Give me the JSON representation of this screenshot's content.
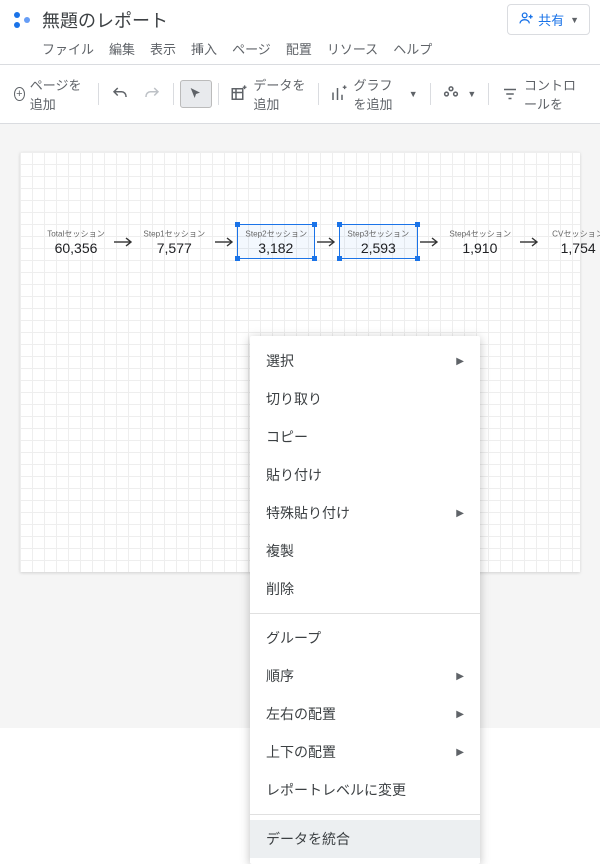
{
  "header": {
    "title": "無題のレポート",
    "share": "共有",
    "menu": [
      "ファイル",
      "編集",
      "表示",
      "挿入",
      "ページ",
      "配置",
      "リソース",
      "ヘルプ"
    ]
  },
  "toolbar": {
    "addPage": "ページを追加",
    "addData": "データを追加",
    "addChart": "グラフを追加",
    "addControl": "コントロールを"
  },
  "flow": {
    "nodes": [
      {
        "label": "Totalセッション",
        "value": "60,356"
      },
      {
        "label": "Step1セッション",
        "value": "7,577"
      },
      {
        "label": "Step2セッション",
        "value": "3,182"
      },
      {
        "label": "Step3セッション",
        "value": "2,593"
      },
      {
        "label": "Step4セッション",
        "value": "1,910"
      },
      {
        "label": "CVセッション",
        "value": "1,754"
      }
    ]
  },
  "context": {
    "select": "選択",
    "cut": "切り取り",
    "copy": "コピー",
    "paste": "貼り付け",
    "pasteSpecial": "特殊貼り付け",
    "duplicate": "複製",
    "delete": "削除",
    "group": "グループ",
    "order": "順序",
    "alignH": "左右の配置",
    "alignV": "上下の配置",
    "reportLevel": "レポートレベルに変更",
    "blendData": "データを統合"
  }
}
